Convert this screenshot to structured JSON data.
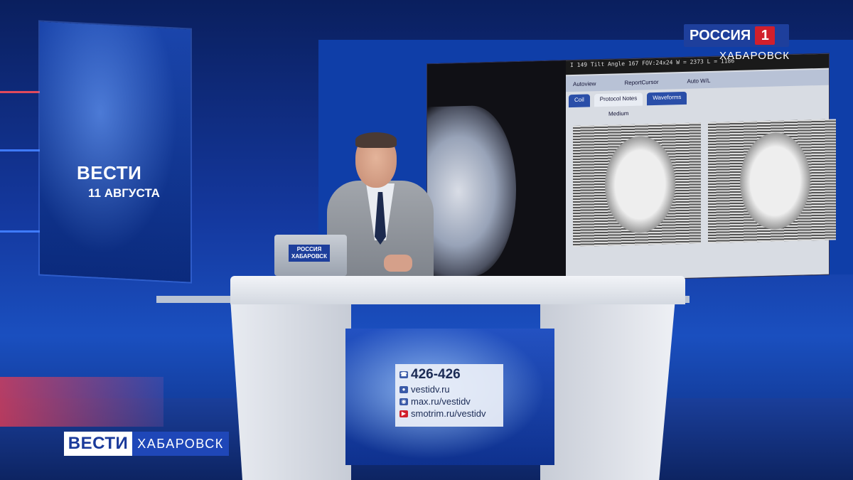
{
  "channel": {
    "name": "РОССИЯ",
    "number": "1",
    "city": "ХАБАРОВСК"
  },
  "left_panel": {
    "title": "ВЕСТИ",
    "date": "11 АВГУСТА"
  },
  "laptop": {
    "logo_line1": "РОССИЯ",
    "logo_line2": "ХАБАРОВСК"
  },
  "scan_screen": {
    "topbar_text": "I 149   Tilt Angle 167   FOV:24x24   W = 2373 L = 1186",
    "options": [
      "Autoview",
      "ReportCursor",
      "Auto W/L"
    ],
    "tabs": [
      "Coil",
      "Protocol Notes",
      "Waveforms"
    ],
    "field": "Medium"
  },
  "contacts": {
    "phone": "426-426",
    "links": [
      "vestidv.ru",
      "max.ru/vestidv",
      "smotrim.ru/vestidv"
    ]
  },
  "lower_third": {
    "brand": "ВЕСТИ",
    "city": "ХАБАРОВСК"
  },
  "colors": {
    "brand_blue": "#1e3f9c",
    "brand_red": "#d11f2c",
    "studio_blue": "#14389e"
  }
}
